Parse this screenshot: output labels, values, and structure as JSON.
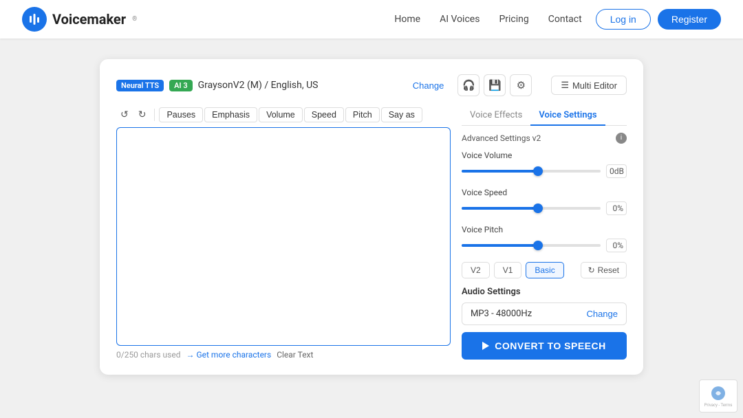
{
  "nav": {
    "logo_text": "Voicemaker",
    "links": [
      {
        "label": "Home",
        "key": "home"
      },
      {
        "label": "AI Voices",
        "key": "ai-voices"
      },
      {
        "label": "Pricing",
        "key": "pricing"
      },
      {
        "label": "Contact",
        "key": "contact"
      }
    ],
    "login_label": "Log in",
    "register_label": "Register"
  },
  "voice_bar": {
    "badge_neural": "Neural TTS",
    "badge_ai": "AI 3",
    "voice_name": "GraysonV2 (M) / English, US",
    "change_label": "Change",
    "headphone_icon": "🎧",
    "save_icon": "💾",
    "settings_icon": "⚙",
    "multi_editor_icon": "☰",
    "multi_editor_label": "Multi Editor"
  },
  "toolbar": {
    "undo": "↺",
    "redo": "↻",
    "pauses": "Pauses",
    "emphasis": "Emphasis",
    "volume": "Volume",
    "speed": "Speed",
    "pitch": "Pitch",
    "say_as": "Say as"
  },
  "editor": {
    "placeholder": "",
    "char_count": "0/250 chars used",
    "get_more": "→ Get more characters",
    "clear_text": "Clear Text"
  },
  "right_panel": {
    "tab_effects": "Voice Effects",
    "tab_settings": "Voice Settings",
    "advanced_label": "Advanced Settings v2",
    "voice_volume_label": "Voice Volume",
    "voice_volume_value": "0dB",
    "voice_volume_pct": 55,
    "voice_speed_label": "Voice Speed",
    "voice_speed_value": "0%",
    "voice_speed_pct": 55,
    "voice_pitch_label": "Voice Pitch",
    "voice_pitch_value": "0%",
    "voice_pitch_pct": 55,
    "ver_v2": "V2",
    "ver_v1": "V1",
    "ver_basic": "Basic",
    "reset_icon": "↻",
    "reset_label": "Reset",
    "audio_settings_label": "Audio Settings",
    "audio_format": "MP3 - 48000Hz",
    "audio_change": "Change",
    "convert_label": "CONVERT TO SPEECH"
  },
  "recaptcha": {
    "line1": "Privacy",
    "sep": "-",
    "line2": "Terms"
  }
}
